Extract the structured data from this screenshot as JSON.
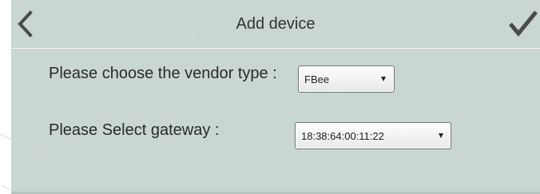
{
  "header": {
    "title": "Add device",
    "back_icon": "chevron-left-icon",
    "confirm_icon": "checkmark-icon"
  },
  "form": {
    "vendor_label": "Please choose the vendor type :",
    "vendor_value": "FBee",
    "gateway_label": "Please Select gateway :",
    "gateway_value": "18:38:64:00:11:22"
  },
  "colors": {
    "background": "#c9d6d1",
    "text": "#2b2b2b"
  }
}
